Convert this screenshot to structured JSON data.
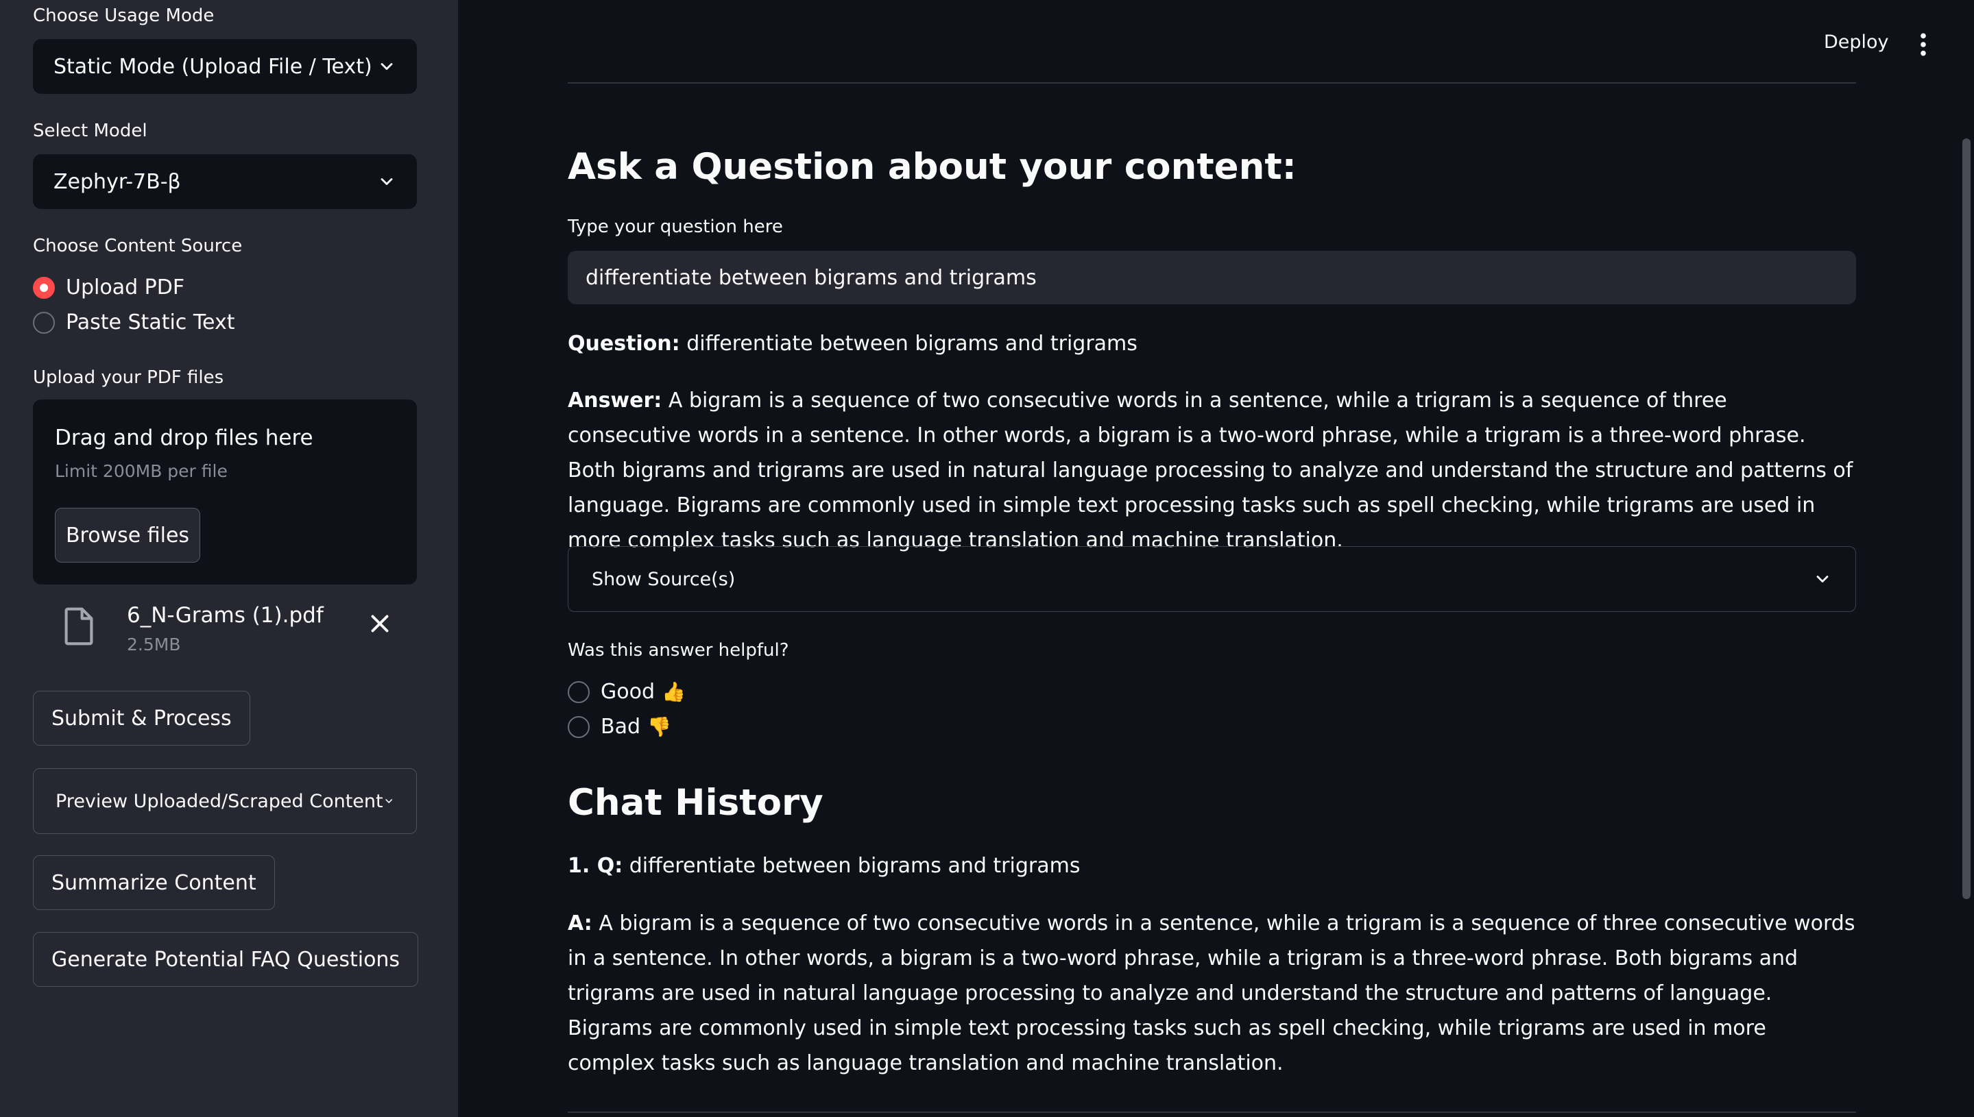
{
  "sidebar": {
    "usage_mode_label": "Choose Usage Mode",
    "usage_mode_value": "Static Mode (Upload File / Text)",
    "model_label": "Select Model",
    "model_value": "Zephyr-7B-β",
    "content_source_label": "Choose Content Source",
    "content_source_options": [
      {
        "label": "Upload PDF",
        "checked": true
      },
      {
        "label": "Paste Static Text",
        "checked": false
      }
    ],
    "upload_label": "Upload your PDF files",
    "dropzone_title": "Drag and drop files here",
    "dropzone_limit": "Limit 200MB per file",
    "browse_label": "Browse files",
    "file_name": "6_N-Grams (1).pdf",
    "file_size": "2.5MB",
    "submit_label": "Submit & Process",
    "preview_label": "Preview Uploaded/Scraped Content",
    "summarize_label": "Summarize Content",
    "faq_label": "Generate Potential FAQ Questions"
  },
  "topbar": {
    "deploy_label": "Deploy",
    "menu_icon": "kebab-menu-icon"
  },
  "main": {
    "ask_heading": "Ask a Question about your content:",
    "question_field_label": "Type your question here",
    "question_value": "differentiate between bigrams and trigrams",
    "question_prefix": "Question:",
    "question_text": "differentiate between bigrams and trigrams",
    "answer_prefix": "Answer:",
    "answer_text": "A bigram is a sequence of two consecutive words in a sentence, while a trigram is a sequence of three consecutive words in a sentence. In other words, a bigram is a two-word phrase, while a trigram is a three-word phrase. Both bigrams and trigrams are used in natural language processing to analyze and understand the structure and patterns of language. Bigrams are commonly used in simple text processing tasks such as spell checking, while trigrams are used in more complex tasks such as language translation and machine translation.",
    "sources_label": "Show Source(s)",
    "feedback_label": "Was this answer helpful?",
    "feedback_options": [
      {
        "label": "Good",
        "emoji": "👍"
      },
      {
        "label": "Bad",
        "emoji": "👎"
      }
    ],
    "history_heading": "Chat History",
    "history": [
      {
        "q_prefix": "1. Q:",
        "q_text": "differentiate between bigrams and trigrams",
        "a_prefix": "A:",
        "a_text": "A bigram is a sequence of two consecutive words in a sentence, while a trigram is a sequence of three consecutive words in a sentence. In other words, a bigram is a two-word phrase, while a trigram is a three-word phrase. Both bigrams and trigrams are used in natural language processing to analyze and understand the structure and patterns of language. Bigrams are commonly used in simple text processing tasks such as spell checking, while trigrams are used in more complex tasks such as language translation and machine translation."
      }
    ]
  },
  "colors": {
    "sidebar_bg": "#262730",
    "main_bg": "#0e1117",
    "accent": "#ff4b4b"
  }
}
